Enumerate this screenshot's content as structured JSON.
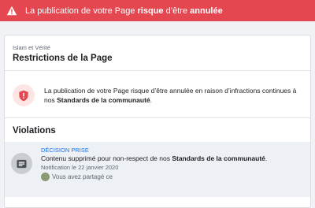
{
  "banner": {
    "text_before": "La publication de votre Page ",
    "text_bold1": "risque",
    "text_middle": " d’être ",
    "text_bold2": "annulée",
    "icon": "warning-icon",
    "color": "#e4474f"
  },
  "page": {
    "name": "Islam et Vérité",
    "title": "Restrictions de la Page"
  },
  "notice": {
    "icon": "shield-icon",
    "text": "La publication de votre Page risque d’être annulée en raison d’infractions continues à nos ",
    "bold": "Standards de la communauté",
    "suffix": "."
  },
  "violations": {
    "title": "Violations",
    "items": [
      {
        "status": "DÉCISION PRISE",
        "description": "Contenu supprimé pour non-respect de nos ",
        "description_bold": "Standards de la communauté",
        "description_suffix": ".",
        "date": "Notification le 22 janvier 2020",
        "shared_text": "Vous avez partagé ce",
        "icon": "message-icon"
      }
    ]
  }
}
